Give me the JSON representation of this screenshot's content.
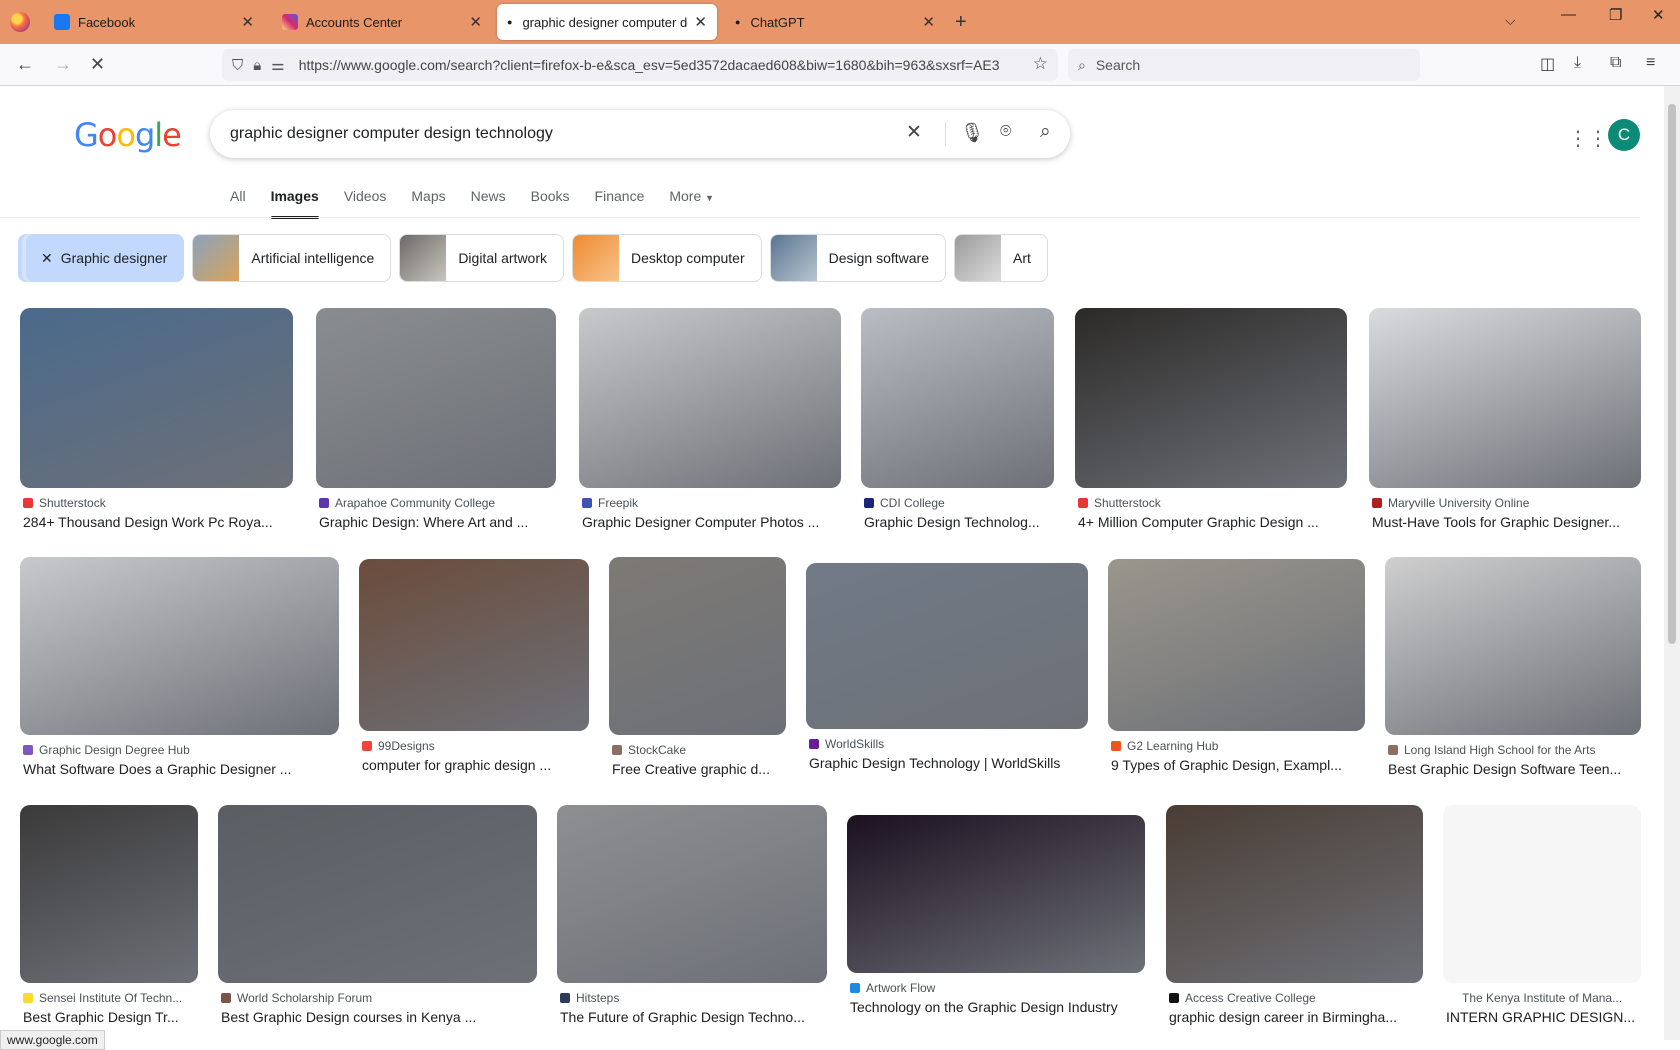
{
  "browser": {
    "tabs": [
      {
        "label": "Facebook",
        "favicon_color": "#1877f2"
      },
      {
        "label": "Accounts Center",
        "favicon_color": "#e1306c"
      },
      {
        "label": "graphic designer computer design",
        "favicon_color": "#555555"
      },
      {
        "label": "ChatGPT",
        "favicon_color": "#555555"
      }
    ],
    "new_tab": "+",
    "url": "https://www.google.com/search?client=firefox-b-e&sca_esv=5ed3572dacaed608&biw=1680&bih=963&sxsrf=AE3",
    "search_placeholder": "Search",
    "status_url": "www.google.com"
  },
  "google": {
    "logo": "Google",
    "query": "graphic designer computer design technology",
    "avatar_letter": "C",
    "tabs": [
      "All",
      "Images",
      "Videos",
      "Maps",
      "News",
      "Books",
      "Finance",
      "More"
    ],
    "selected_tab": "Images",
    "chips": [
      {
        "label": "Graphic designer",
        "selected": true
      },
      {
        "label": "Artificial intelligence"
      },
      {
        "label": "Digital artwork"
      },
      {
        "label": "Desktop computer"
      },
      {
        "label": "Design software"
      },
      {
        "label": "Art"
      }
    ]
  },
  "results": [
    {
      "source": "Shutterstock",
      "title": "284+ Thousand Design Work Pc Roya...",
      "color": "#4a6a8c",
      "icon": "#e53935"
    },
    {
      "source": "Arapahoe Community College",
      "title": "Graphic Design: Where Art and ...",
      "color": "#8a8d90",
      "icon": "#5e35b1"
    },
    {
      "source": "Freepik",
      "title": "Graphic Designer Computer Photos ...",
      "color": "#c8c9cb",
      "icon": "#3f51b5"
    },
    {
      "source": "CDI College",
      "title": "Graphic Design Technolog...",
      "color": "#b9bec4",
      "icon": "#1a237e"
    },
    {
      "source": "Shutterstock",
      "title": "4+ Million Computer Graphic Design ...",
      "color": "#2c2a28",
      "icon": "#e53935"
    },
    {
      "source": "Maryville University Online",
      "title": "Must-Have Tools for Graphic Designer...",
      "color": "#d9dbde",
      "icon": "#b71c1c"
    },
    {
      "source": "Graphic Design Degree Hub",
      "title": "What Software Does a Graphic Designer ...",
      "color": "#c7c9cc",
      "icon": "#7e57c2"
    },
    {
      "source": "99Designs",
      "title": "computer for graphic design ...",
      "color": "#6b4c3b",
      "icon": "#f44336"
    },
    {
      "source": "StockCake",
      "title": "Free Creative graphic d...",
      "color": "#7d7a75",
      "icon": "#8d6e63"
    },
    {
      "source": "WorldSkills",
      "title": "Graphic Design Technology | WorldSkills",
      "color": "#707a86",
      "icon": "#6a1b9a"
    },
    {
      "source": "G2 Learning Hub",
      "title": "9 Types of Graphic Design, Exampl...",
      "color": "#9a968c",
      "icon": "#f4511e"
    },
    {
      "source": "Long Island High School for the Arts",
      "title": "Best Graphic Design Software Teen...",
      "color": "#cfcfcf",
      "icon": "#8d6e63"
    },
    {
      "source": "Sensei Institute Of Techn...",
      "title": "Best Graphic Design Tr...",
      "color": "#3b3a3a",
      "icon": "#fdd835"
    },
    {
      "source": "World Scholarship Forum",
      "title": "Best Graphic Design courses in Kenya ...",
      "color": "#5a5e63",
      "icon": "#795548"
    },
    {
      "source": "Hitsteps",
      "title": "The Future of Graphic Design Techno...",
      "color": "#8d8f92",
      "icon": "#2e3a59"
    },
    {
      "source": "Artwork Flow",
      "title": "Technology on the Graphic Design Industry",
      "color": "#1b1020",
      "icon": "#1e88e5"
    },
    {
      "source": "Access Creative College",
      "title": "graphic design career in Birmingha...",
      "color": "#4a3d34",
      "icon": "#111111"
    },
    {
      "source": "The Kenya Institute of Mana...",
      "title": "INTERN GRAPHIC DESIGN...",
      "color": "#fafafa",
      "icon": "#ffffff"
    }
  ]
}
